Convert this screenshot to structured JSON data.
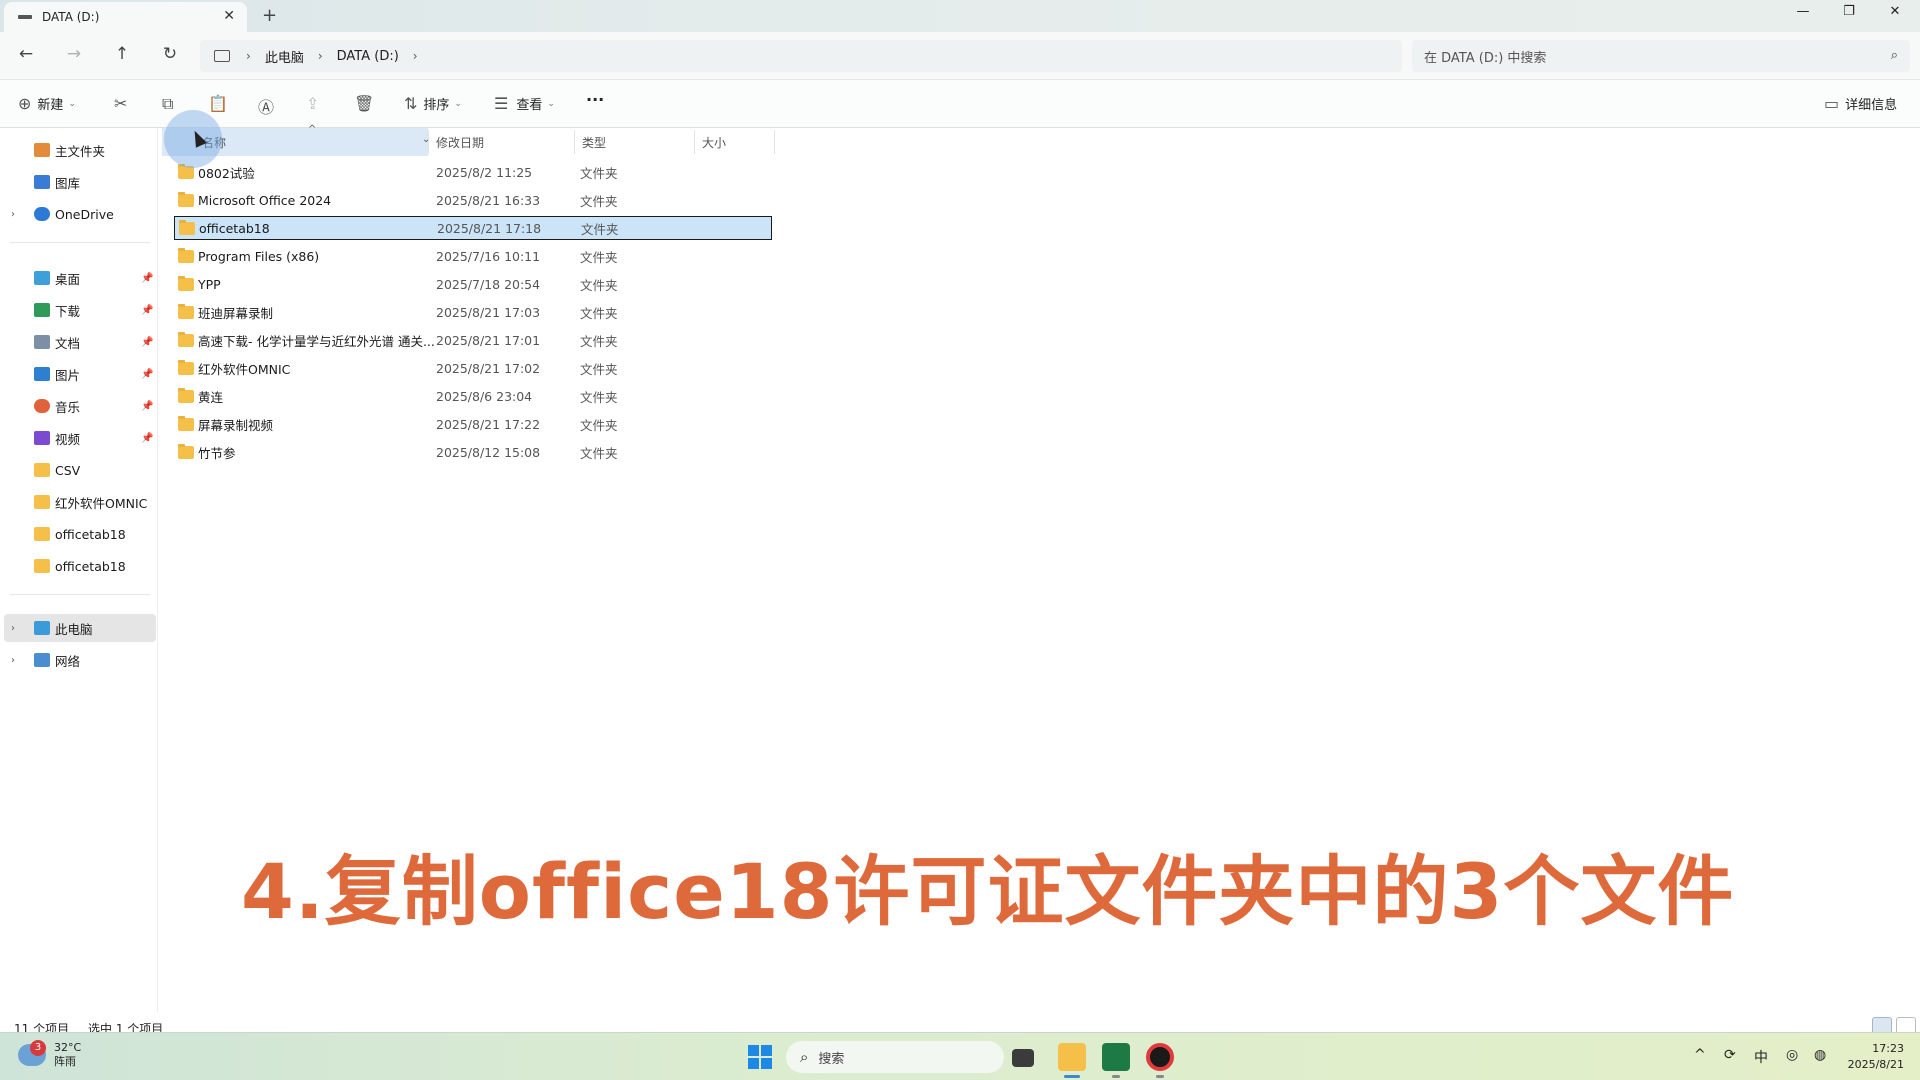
{
  "window": {
    "tab_title": "DATA (D:)",
    "tab_close": "✕",
    "new_tab": "+",
    "minimize": "—",
    "maximize": "❐",
    "close": "✕"
  },
  "nav": {
    "back": "←",
    "forward": "→",
    "up": "↑",
    "refresh": "↻",
    "breadcrumb": [
      "此电脑",
      "DATA (D:)"
    ],
    "crumb_sep": "›",
    "search_placeholder": "在 DATA (D:) 中搜索",
    "search_glyph": "⌕"
  },
  "toolbar": {
    "new_label": "新建",
    "sort_label": "排序",
    "view_label": "查看",
    "details_label": "详细信息",
    "more_label": "···",
    "icons": {
      "new": "⊕",
      "cut": "✂",
      "copy": "⧉",
      "paste": "📋",
      "rename": "Ⓐ",
      "share": "⇪",
      "delete": "🗑",
      "sort": "⇅",
      "view": "☰",
      "details": "▭"
    }
  },
  "sidebar": {
    "quick": [
      {
        "label": "主文件夹",
        "icon": "home-icon",
        "color": "#e38b3a",
        "chev": false
      },
      {
        "label": "图库",
        "icon": "gallery-icon",
        "color": "#3a7bd5",
        "chev": false
      },
      {
        "label": "OneDrive",
        "icon": "onedrive-icon",
        "color": "#2d7ad6",
        "chev": true
      }
    ],
    "pinned": [
      {
        "label": "桌面",
        "icon": "desktop-icon",
        "color": "#3ea0d8"
      },
      {
        "label": "下载",
        "icon": "download-icon",
        "color": "#2e9b5a"
      },
      {
        "label": "文档",
        "icon": "documents-icon",
        "color": "#7d8fa6"
      },
      {
        "label": "图片",
        "icon": "pictures-icon",
        "color": "#2f7fd1"
      },
      {
        "label": "音乐",
        "icon": "music-icon",
        "color": "#e0623a"
      },
      {
        "label": "视频",
        "icon": "videos-icon",
        "color": "#7b4ad0"
      }
    ],
    "folders": [
      "CSV",
      "红外软件OMNIC",
      "officetab18",
      "officetab18"
    ],
    "devices": [
      {
        "label": "此电脑",
        "icon": "this-pc-icon",
        "color": "#3a9bd8",
        "active": true
      },
      {
        "label": "网络",
        "icon": "network-icon",
        "color": "#4a8ed0",
        "active": false
      }
    ],
    "pin_glyph": "📌",
    "chev_glyph": "›"
  },
  "columns": {
    "name": "名称",
    "date": "修改日期",
    "type": "类型",
    "size": "大小",
    "sort_glyph": "^",
    "dd_glyph": "⌄"
  },
  "files": [
    {
      "name": "0802试验",
      "date": "2025/8/2 11:25",
      "type": "文件夹",
      "selected": false
    },
    {
      "name": "Microsoft Office 2024",
      "date": "2025/8/21 16:33",
      "type": "文件夹",
      "selected": false
    },
    {
      "name": "officetab18",
      "date": "2025/8/21 17:18",
      "type": "文件夹",
      "selected": true
    },
    {
      "name": "Program Files (x86)",
      "date": "2025/7/16 10:11",
      "type": "文件夹",
      "selected": false
    },
    {
      "name": "YPP",
      "date": "2025/7/18 20:54",
      "type": "文件夹",
      "selected": false
    },
    {
      "name": "班迪屏幕录制",
      "date": "2025/8/21 17:03",
      "type": "文件夹",
      "selected": false
    },
    {
      "name": "高速下载- 化学计量学与近红外光谱 通关...",
      "date": "2025/8/21 17:01",
      "type": "文件夹",
      "selected": false
    },
    {
      "name": "红外软件OMNIC",
      "date": "2025/8/21 17:02",
      "type": "文件夹",
      "selected": false
    },
    {
      "name": "黄连",
      "date": "2025/8/6 23:04",
      "type": "文件夹",
      "selected": false
    },
    {
      "name": "屏幕录制视频",
      "date": "2025/8/21 17:22",
      "type": "文件夹",
      "selected": false
    },
    {
      "name": "竹节参",
      "date": "2025/8/12 15:08",
      "type": "文件夹",
      "selected": false
    }
  ],
  "caption": "4.复制office18许可证文件夹中的3个文件",
  "status": {
    "item_count": "11 个项目",
    "selected_count": "选中 1 个项目"
  },
  "taskbar": {
    "weather_temp": "32°C",
    "weather_desc": "阵雨",
    "weather_badge": "3",
    "search_label": "搜索",
    "search_glyph": "⌕",
    "tray_chevron": "^",
    "ime": "中",
    "time": "17:23",
    "date": "2025/8/21"
  }
}
